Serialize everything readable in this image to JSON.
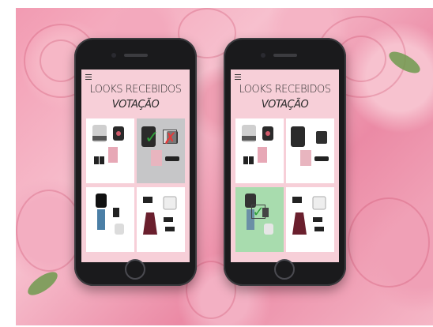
{
  "screens": [
    {
      "title_line1": "LOOKS RECEBIDOS",
      "title_line2": "VOTAÇÃO",
      "menu_icon": "hamburger-menu-icon",
      "selection": {
        "approve_icon": "check-icon",
        "reject_icon": "close-icon",
        "selected_tile": "look-2"
      }
    },
    {
      "title_line1": "LOOKS RECEBIDOS",
      "title_line2": "VOTAÇÃO",
      "menu_icon": "hamburger-menu-icon",
      "selection": {
        "approve_icon": "check-icon",
        "selected_tile": "look-3"
      }
    }
  ],
  "colors": {
    "screen_bg": "#f7cfd8",
    "approve": "#2e9e3a",
    "reject": "#e23a3a",
    "voted_gray": "#c6c6c8",
    "voted_green": "#a8dcae"
  },
  "glyphs": {
    "check": "✓",
    "x": "✗"
  }
}
